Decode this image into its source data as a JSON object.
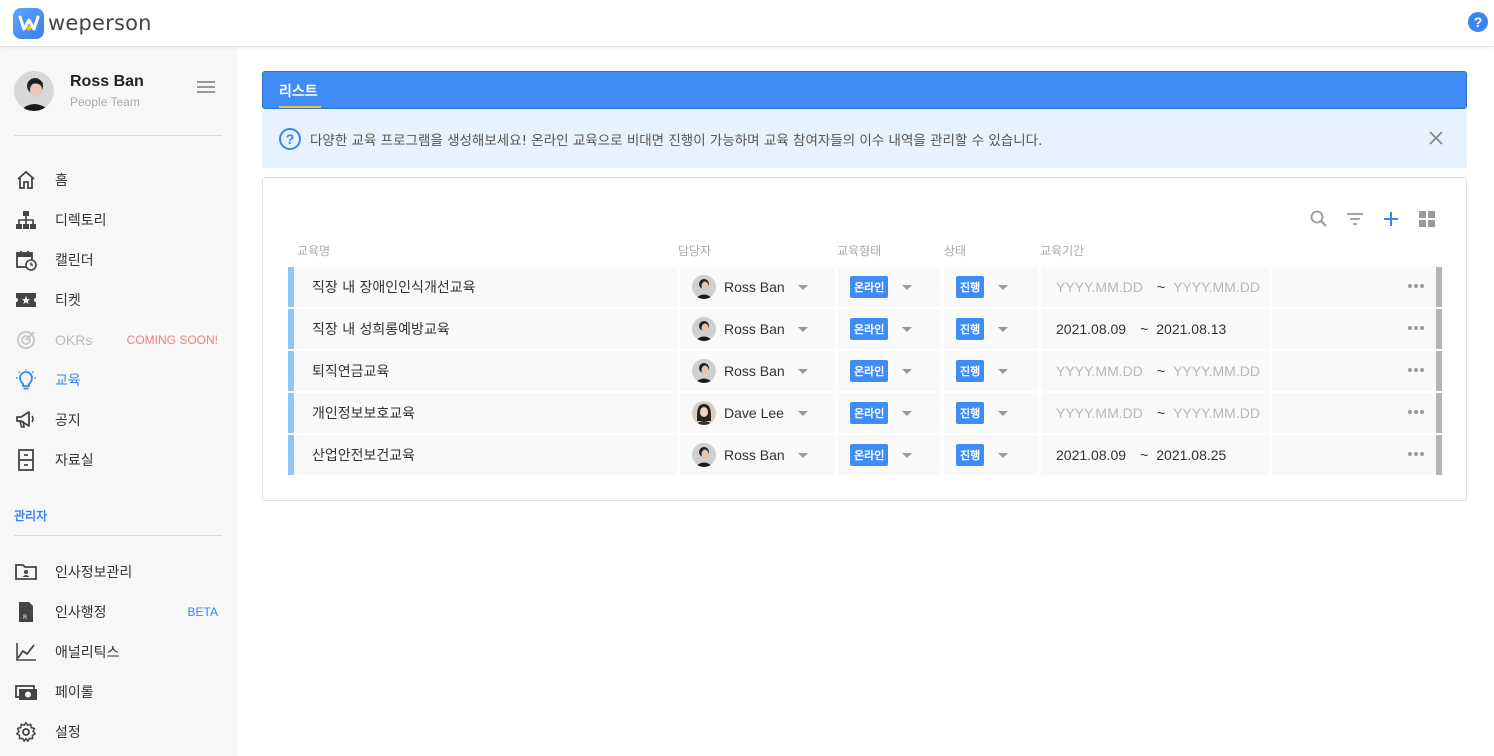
{
  "app": {
    "logo_text": "weperson",
    "help_label": "?"
  },
  "profile": {
    "name": "Ross Ban",
    "team": "People Team"
  },
  "sidebar": {
    "items": [
      {
        "label": "홈",
        "icon": "home-icon"
      },
      {
        "label": "디렉토리",
        "icon": "org-chart-icon"
      },
      {
        "label": "캘린더",
        "icon": "calendar-icon"
      },
      {
        "label": "티켓",
        "icon": "ticket-icon"
      },
      {
        "label": "OKRs",
        "icon": "target-icon",
        "badge": "COMING SOON!",
        "badge_color": "#f08080",
        "disabled": true
      },
      {
        "label": "교육",
        "icon": "lightbulb-icon",
        "active": true
      },
      {
        "label": "공지",
        "icon": "megaphone-icon"
      },
      {
        "label": "자료실",
        "icon": "cabinet-icon"
      }
    ],
    "admin_section_label": "관리자",
    "admin_items": [
      {
        "label": "인사정보관리",
        "icon": "id-card-icon"
      },
      {
        "label": "인사행정",
        "icon": "document-icon",
        "badge": "BETA",
        "badge_color": "#3a86f0"
      },
      {
        "label": "애널리틱스",
        "icon": "line-chart-icon"
      },
      {
        "label": "페이롤",
        "icon": "money-icon"
      },
      {
        "label": "설정",
        "icon": "gear-icon"
      }
    ]
  },
  "main": {
    "tab_label": "리스트",
    "info_text": "다양한 교육 프로그램을 생성해보세요! 온라인 교육으로 비대면 진행이 가능하며 교육 참여자들의 이수 내역을 관리할 수 있습니다.",
    "columns": {
      "name": "교육명",
      "manager": "담당자",
      "type": "교육형태",
      "status": "상태",
      "period": "교육기간"
    },
    "rows": [
      {
        "name": "직장 내 장애인인식개선교육",
        "manager": "Ross Ban",
        "type": "온라인",
        "status": "진행",
        "start": "YYYY.MM.DD",
        "end": "YYYY.MM.DD",
        "start_set": false,
        "end_set": false
      },
      {
        "name": "직장 내 성희롱예방교육",
        "manager": "Ross Ban",
        "type": "온라인",
        "status": "진행",
        "start": "2021.08.09",
        "end": "2021.08.13",
        "start_set": true,
        "end_set": true
      },
      {
        "name": "퇴직연금교육",
        "manager": "Ross Ban",
        "type": "온라인",
        "status": "진행",
        "start": "YYYY.MM.DD",
        "end": "YYYY.MM.DD",
        "start_set": false,
        "end_set": false
      },
      {
        "name": "개인정보보호교육",
        "manager": "Dave Lee",
        "type": "온라인",
        "status": "진행",
        "start": "YYYY.MM.DD",
        "end": "YYYY.MM.DD",
        "start_set": false,
        "end_set": false
      },
      {
        "name": "산업안전보건교육",
        "manager": "Ross Ban",
        "type": "온라인",
        "status": "진행",
        "start": "2021.08.09",
        "end": "2021.08.25",
        "start_set": true,
        "end_set": true
      }
    ],
    "tilde": "~"
  },
  "colors": {
    "accent": "#3a86f0",
    "tab_bg": "#3f8cf5",
    "info_bg": "#e6f2fd",
    "row_accent": "#8ec7f5"
  }
}
